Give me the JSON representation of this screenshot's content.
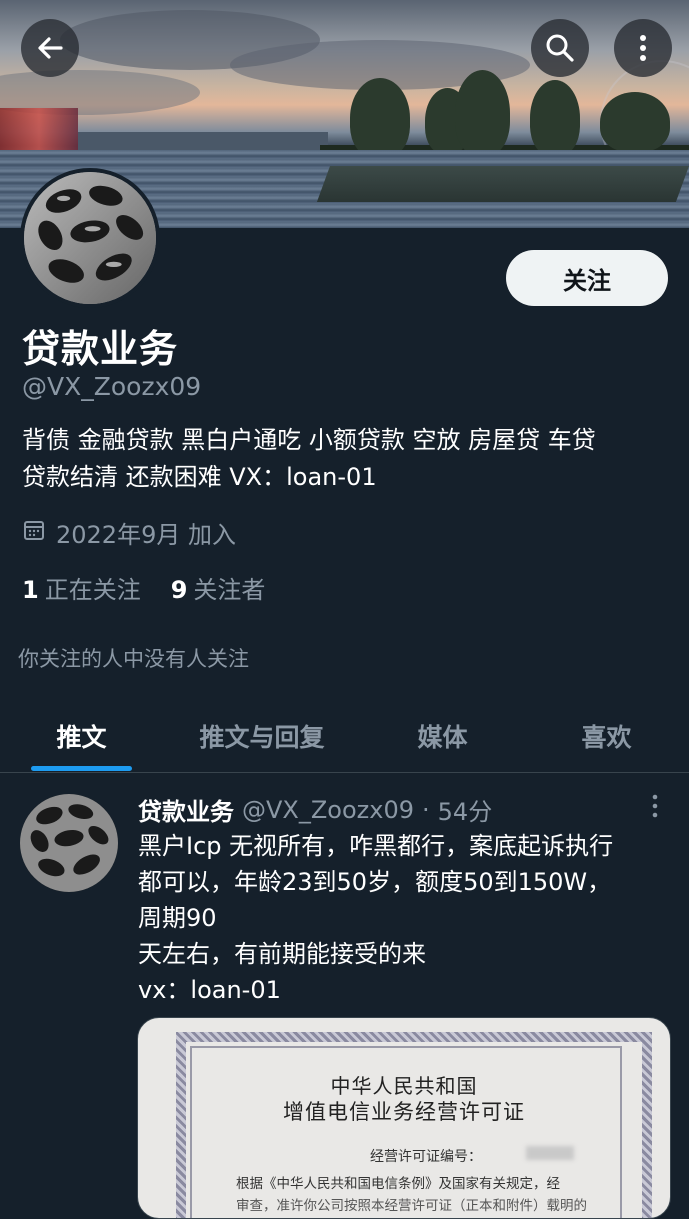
{
  "header": {
    "back_icon": "arrow-left-icon",
    "search_icon": "search-icon",
    "more_icon": "more-vertical-icon"
  },
  "profile": {
    "follow_button_label": "关注",
    "name": "贷款业务",
    "handle": "@VX_Zoozx09",
    "bio_line1": "背债 金融贷款 黑白户通吃 小额贷款 空放 房屋贷 车贷",
    "bio_line2": "贷款结清 还款困难 VX：loan-01",
    "joined": "2022年9月 加入",
    "following_count": "1",
    "following_label": "正在关注",
    "followers_count": "9",
    "followers_label": "关注者",
    "mutual_text": "你关注的人中没有人关注"
  },
  "tabs": [
    {
      "label": "推文",
      "active": true
    },
    {
      "label": "推文与回复",
      "active": false
    },
    {
      "label": "媒体",
      "active": false
    },
    {
      "label": "喜欢",
      "active": false
    }
  ],
  "tweet": {
    "name": "贷款业务",
    "handle": "@VX_Zoozx09",
    "dot": "·",
    "time": "54分",
    "lines": [
      "黑户Icp 无视所有，咋黑都行，案底起诉执行",
      "都可以，年龄23到50岁，额度50到150W，",
      "周期90",
      "天左右，有前期能接受的来",
      "vx：loan-01"
    ],
    "image_text": {
      "title1": "中华人民共和国",
      "title2": "增值电信业务经营许可证",
      "number_label": "经营许可证编号：",
      "body1": "根据《中华人民共和国电信条例》及国家有关规定，经",
      "body2": "审查，准许你公司按照本经营许可证（正本和附件）载明的"
    }
  },
  "colors": {
    "background": "#15202b",
    "accent": "#1d9bf0",
    "secondary_text": "#8b98a5",
    "follow_button_bg": "#eff3f4"
  }
}
